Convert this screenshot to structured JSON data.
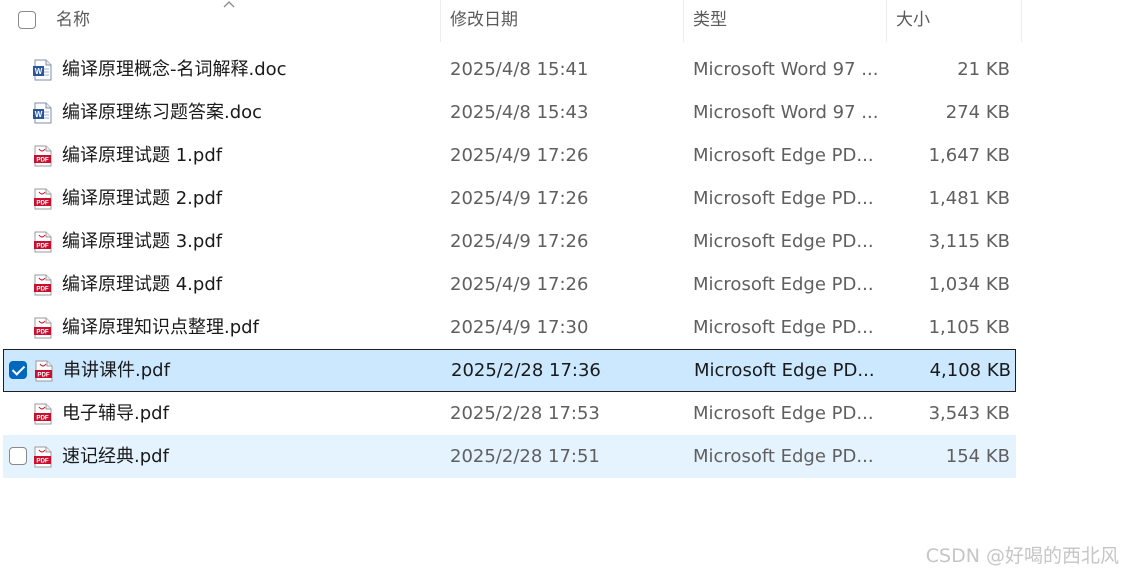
{
  "header": {
    "name_label": "名称",
    "date_label": "修改日期",
    "type_label": "类型",
    "size_label": "大小"
  },
  "files": [
    {
      "name": "编译原理概念-名词解释.doc",
      "date": "2025/4/8 15:41",
      "type": "Microsoft Word 97 ...",
      "size": "21 KB",
      "icon": "word-doc-icon",
      "state": "normal"
    },
    {
      "name": "编译原理练习题答案.doc",
      "date": "2025/4/8 15:43",
      "type": "Microsoft Word 97 ...",
      "size": "274 KB",
      "icon": "word-doc-icon",
      "state": "normal"
    },
    {
      "name": "编译原理试题 1.pdf",
      "date": "2025/4/9 17:26",
      "type": "Microsoft Edge PD...",
      "size": "1,647 KB",
      "icon": "pdf-icon",
      "state": "normal"
    },
    {
      "name": "编译原理试题 2.pdf",
      "date": "2025/4/9 17:26",
      "type": "Microsoft Edge PD...",
      "size": "1,481 KB",
      "icon": "pdf-icon",
      "state": "normal"
    },
    {
      "name": "编译原理试题 3.pdf",
      "date": "2025/4/9 17:26",
      "type": "Microsoft Edge PD...",
      "size": "3,115 KB",
      "icon": "pdf-icon",
      "state": "normal"
    },
    {
      "name": "编译原理试题 4.pdf",
      "date": "2025/4/9 17:26",
      "type": "Microsoft Edge PD...",
      "size": "1,034 KB",
      "icon": "pdf-icon",
      "state": "normal"
    },
    {
      "name": "编译原理知识点整理.pdf",
      "date": "2025/4/9 17:30",
      "type": "Microsoft Edge PD...",
      "size": "1,105 KB",
      "icon": "pdf-icon",
      "state": "normal"
    },
    {
      "name": "串讲课件.pdf",
      "date": "2025/2/28 17:36",
      "type": "Microsoft Edge PD...",
      "size": "4,108 KB",
      "icon": "pdf-icon",
      "state": "selected"
    },
    {
      "name": "电子辅导.pdf",
      "date": "2025/2/28 17:53",
      "type": "Microsoft Edge PD...",
      "size": "3,543 KB",
      "icon": "pdf-icon",
      "state": "normal"
    },
    {
      "name": "速记经典.pdf",
      "date": "2025/2/28 17:51",
      "type": "Microsoft Edge PD...",
      "size": "154 KB",
      "icon": "pdf-icon",
      "state": "hovered"
    }
  ],
  "colors": {
    "selected_bg": "#cce8ff",
    "hover_bg": "#e5f3ff",
    "checkbox_accent": "#0067c0",
    "pdf_red": "#c8102e",
    "word_blue": "#2b579a"
  },
  "watermark": "CSDN @好喝的西北风"
}
